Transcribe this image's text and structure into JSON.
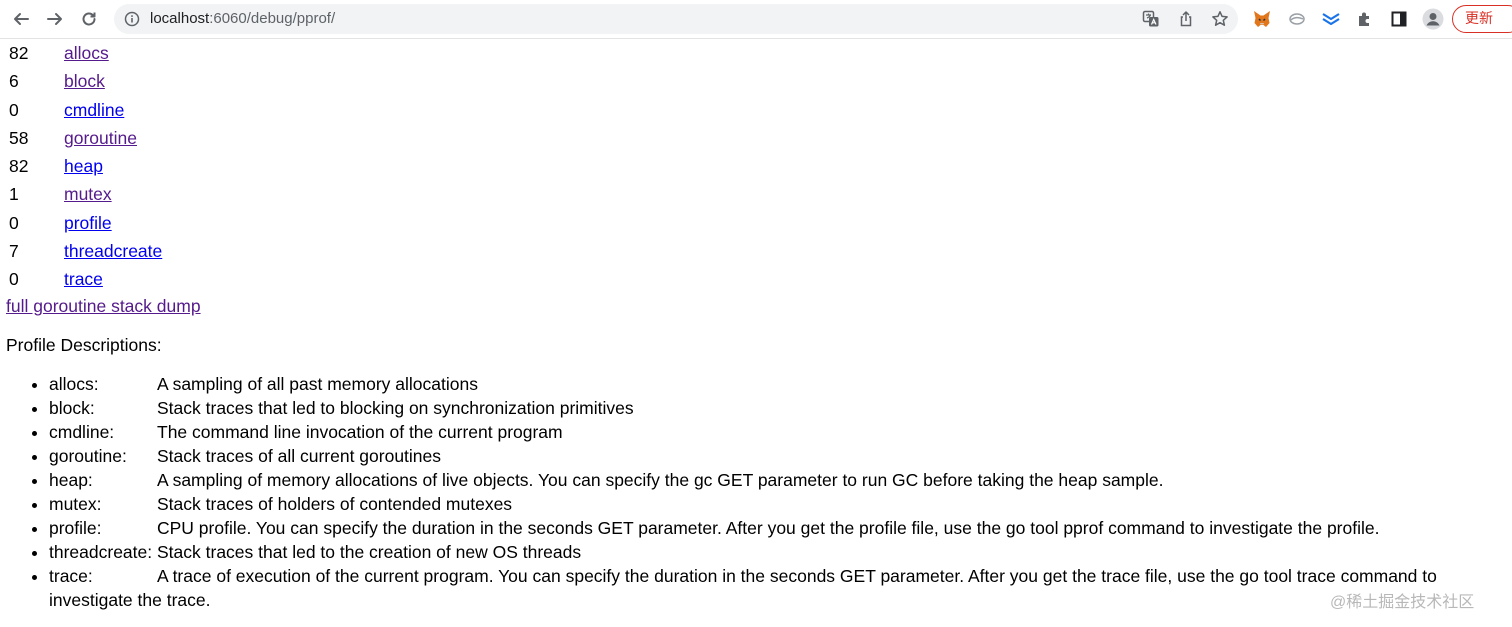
{
  "browser": {
    "url_host": "localhost",
    "url_path": ":6060/debug/pprof/",
    "update_label": "更新",
    "update_menu": "⋮",
    "accent": "#d93025"
  },
  "profiles": [
    {
      "count": "82",
      "name": "allocs",
      "visited": true
    },
    {
      "count": "6",
      "name": "block",
      "visited": true
    },
    {
      "count": "0",
      "name": "cmdline",
      "visited": false
    },
    {
      "count": "58",
      "name": "goroutine",
      "visited": true
    },
    {
      "count": "82",
      "name": "heap",
      "visited": false
    },
    {
      "count": "1",
      "name": "mutex",
      "visited": true
    },
    {
      "count": "0",
      "name": "profile",
      "visited": false
    },
    {
      "count": "7",
      "name": "threadcreate",
      "visited": false
    },
    {
      "count": "0",
      "name": "trace",
      "visited": false
    }
  ],
  "dump_link": "full goroutine stack dump",
  "descriptions_title": "Profile Descriptions:",
  "descriptions": [
    {
      "term": "allocs:",
      "text": "A sampling of all past memory allocations"
    },
    {
      "term": "block:",
      "text": "Stack traces that led to blocking on synchronization primitives"
    },
    {
      "term": "cmdline:",
      "text": "The command line invocation of the current program"
    },
    {
      "term": "goroutine:",
      "text": "Stack traces of all current goroutines"
    },
    {
      "term": "heap:",
      "text": "A sampling of memory allocations of live objects. You can specify the gc GET parameter to run GC before taking the heap sample."
    },
    {
      "term": "mutex:",
      "text": "Stack traces of holders of contended mutexes"
    },
    {
      "term": "profile:",
      "text": "CPU profile. You can specify the duration in the seconds GET parameter. After you get the profile file, use the go tool pprof command to investigate the profile."
    },
    {
      "term": "threadcreate:",
      "text": "Stack traces that led to the creation of new OS threads"
    },
    {
      "term": "trace:",
      "text": "A trace of execution of the current program. You can specify the duration in the seconds GET parameter. After you get the trace file, use the go tool trace command to investigate the trace."
    }
  ],
  "watermark": "@稀土掘金技术社区"
}
